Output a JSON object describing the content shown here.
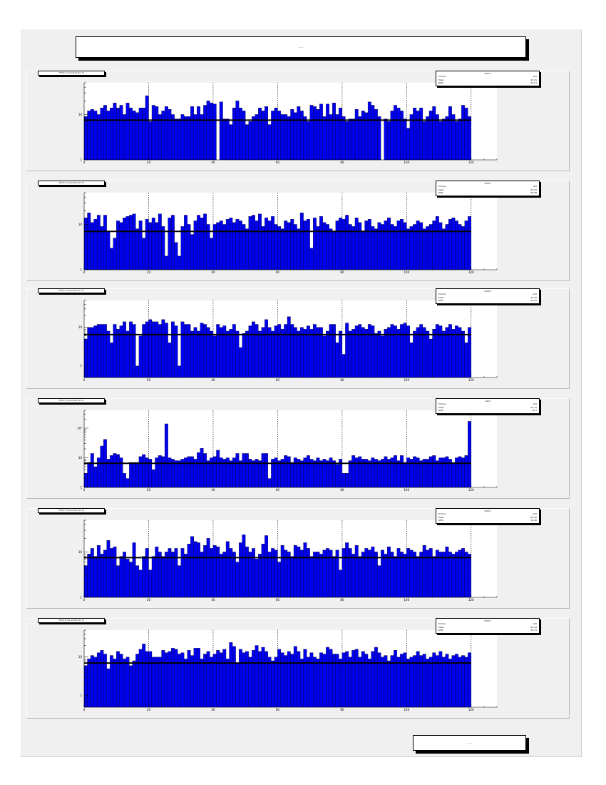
{
  "page": {
    "title": "~~~",
    "footer": "~~~"
  },
  "colors": {
    "fill": "#0000ee",
    "edge": "#000000",
    "mean_line": "#000000",
    "grid": "#000000"
  },
  "chart_data": [
    {
      "type": "bar",
      "hist_title": "TT0-T1 Corrected Pol. B",
      "stats_name": "StdPol",
      "log_y": true,
      "xlim": [
        0,
        128
      ],
      "x_ticks": [
        0,
        20,
        40,
        60,
        80,
        100,
        120
      ],
      "ylim": [
        1,
        50
      ],
      "y_ticks": [
        1,
        10
      ],
      "y_tick_labels": [
        "1",
        "10"
      ],
      "mean_line": 7.5,
      "stats": [
        {
          "label": "Entries",
          "value": "120"
        },
        {
          "label": "Mean",
          "value": "60.61"
        },
        {
          "label": "RMS",
          "value": "34.57"
        }
      ],
      "values": [
        9,
        12,
        13,
        12,
        10,
        14,
        16,
        12,
        14,
        18,
        14,
        16,
        10,
        18,
        14,
        12,
        11,
        14,
        14,
        26,
        7,
        16,
        15,
        10,
        12,
        15,
        13,
        10,
        8,
        8,
        10,
        9,
        9,
        15,
        10,
        15,
        10,
        16,
        20,
        18,
        17,
        1,
        19,
        8,
        8,
        6,
        14,
        20,
        14,
        12,
        6,
        7,
        9,
        10,
        14,
        12,
        15,
        6,
        12,
        14,
        12,
        10,
        10,
        9,
        13,
        11,
        15,
        12,
        9,
        7,
        16,
        15,
        13,
        17,
        9,
        17,
        10,
        18,
        10,
        14,
        9,
        7,
        8,
        8,
        13,
        9,
        12,
        11,
        19,
        16,
        13,
        9,
        1,
        8,
        7,
        12,
        16,
        14,
        12,
        8,
        5,
        10,
        14,
        12,
        14,
        7,
        9,
        12,
        15,
        10,
        7,
        8,
        9,
        15,
        10,
        7,
        8,
        16,
        14,
        9
      ]
    },
    {
      "type": "bar",
      "hist_title": "TS0-T2 Corrected Pol. B",
      "stats_name": "StdPol",
      "log_y": true,
      "xlim": [
        0,
        128
      ],
      "x_ticks": [
        0,
        20,
        40,
        60,
        80,
        100,
        120
      ],
      "ylim": [
        1,
        50
      ],
      "y_ticks": [
        1,
        10
      ],
      "y_tick_labels": [
        "1",
        "10"
      ],
      "mean_line": 7,
      "stats": [
        {
          "label": "Entries",
          "value": "120"
        },
        {
          "label": "Mean",
          "value": "61.52"
        },
        {
          "label": "RMS",
          "value": "34.88"
        }
      ],
      "values": [
        14,
        18,
        11,
        13,
        16,
        9,
        16,
        7,
        3,
        5,
        12,
        11,
        14,
        15,
        16,
        17,
        8,
        12,
        5,
        13,
        11,
        14,
        11,
        17,
        9,
        2,
        14,
        16,
        4,
        2,
        9,
        16,
        10,
        6,
        12,
        16,
        14,
        17,
        10,
        5,
        10,
        11,
        12,
        10,
        13,
        14,
        11,
        13,
        12,
        10,
        8,
        15,
        16,
        12,
        17,
        9,
        14,
        12,
        15,
        10,
        9,
        8,
        12,
        11,
        13,
        10,
        8,
        18,
        12,
        13,
        3,
        14,
        9,
        15,
        11,
        10,
        8,
        7,
        12,
        14,
        13,
        16,
        10,
        9,
        14,
        11,
        7,
        12,
        13,
        9,
        8,
        11,
        10,
        12,
        14,
        10,
        9,
        12,
        13,
        11,
        8,
        9,
        10,
        12,
        11,
        8,
        9,
        10,
        12,
        15,
        11,
        8,
        10,
        13,
        14,
        12,
        10,
        9,
        12,
        15
      ]
    },
    {
      "type": "bar",
      "hist_title": "TS0-T3 Corrected Pol. B",
      "stats_name": "StdPol",
      "log_y": true,
      "xlim": [
        0,
        128
      ],
      "x_ticks": [
        0,
        20,
        40,
        60,
        80,
        100,
        120
      ],
      "ylim": [
        0.5,
        50
      ],
      "y_ticks": [
        1,
        10
      ],
      "y_tick_labels": [
        "1",
        "10"
      ],
      "mean_line": 6.5,
      "stats": [
        {
          "label": "Entries",
          "value": "120"
        },
        {
          "label": "Mean",
          "value": "59.76"
        },
        {
          "label": "RMS",
          "value": "34.61"
        }
      ],
      "values": [
        5,
        10,
        10,
        11,
        12,
        12,
        12,
        8,
        4,
        12,
        9,
        11,
        14,
        8,
        14,
        12,
        1,
        6,
        12,
        14,
        16,
        14,
        14,
        12,
        16,
        13,
        4,
        14,
        11,
        1,
        14,
        12,
        12,
        8,
        10,
        8,
        13,
        12,
        10,
        8,
        6,
        12,
        10,
        11,
        8,
        9,
        12,
        8,
        3,
        7,
        8,
        11,
        14,
        12,
        8,
        10,
        16,
        10,
        8,
        11,
        12,
        9,
        12,
        19,
        12,
        10,
        8,
        10,
        9,
        11,
        9,
        12,
        10,
        10,
        6,
        8,
        12,
        12,
        4,
        8,
        2,
        13,
        8,
        9,
        11,
        12,
        10,
        9,
        12,
        11,
        7,
        8,
        6,
        9,
        10,
        12,
        11,
        9,
        12,
        13,
        11,
        4,
        8,
        10,
        12,
        10,
        8,
        5,
        9,
        12,
        11,
        8,
        10,
        12,
        9,
        11,
        10,
        8,
        4,
        10
      ]
    },
    {
      "type": "bar",
      "hist_title": "TS0-T4 Corrected Pol. B",
      "stats_name": "LaPol",
      "log_y": true,
      "xlim": [
        0,
        128
      ],
      "x_ticks": [
        0,
        20,
        40,
        60,
        80,
        100,
        120
      ],
      "ylim": [
        1,
        400
      ],
      "y_ticks": [
        1,
        10,
        100
      ],
      "y_tick_labels": [
        "1",
        "10",
        "10²"
      ],
      "mean_line": 6.5,
      "stats": [
        {
          "label": "Entries",
          "value": "120"
        },
        {
          "label": "Mean",
          "value": "61.47"
        },
        {
          "label": "RMS",
          "value": "28.7"
        }
      ],
      "values": [
        3,
        7,
        14,
        5,
        10,
        25,
        42,
        9,
        12,
        14,
        13,
        10,
        3,
        2,
        7,
        7,
        7,
        11,
        13,
        10,
        9,
        4,
        10,
        12,
        11,
        140,
        10,
        9,
        8,
        8,
        9,
        10,
        11,
        11,
        9,
        15,
        21,
        14,
        8,
        10,
        11,
        18,
        10,
        9,
        10,
        8,
        10,
        14,
        8,
        14,
        14,
        9,
        8,
        9,
        8,
        14,
        14,
        2,
        9,
        10,
        8,
        9,
        12,
        11,
        7,
        10,
        9,
        8,
        10,
        12,
        9,
        8,
        10,
        8,
        9,
        8,
        10,
        8,
        6,
        9,
        3,
        3,
        8,
        12,
        10,
        11,
        9,
        9,
        8,
        10,
        9,
        8,
        9,
        11,
        9,
        10,
        12,
        8,
        12,
        7,
        10,
        9,
        11,
        10,
        8,
        9,
        9,
        11,
        12,
        8,
        10,
        10,
        11,
        9,
        7,
        10,
        11,
        10,
        12,
        170
      ]
    },
    {
      "type": "bar",
      "hist_title": "TS0-T5 Corrected Pol. B",
      "stats_name": "StdPol",
      "log_y": true,
      "xlim": [
        0,
        128
      ],
      "x_ticks": [
        0,
        20,
        40,
        60,
        80,
        100,
        120
      ],
      "ylim": [
        1,
        50
      ],
      "y_ticks": [
        1,
        10
      ],
      "y_tick_labels": [
        "1",
        "10"
      ],
      "mean_line": 7.5,
      "stats": [
        {
          "label": "Entries",
          "value": "120"
        },
        {
          "label": "Mean",
          "value": "60.06"
        },
        {
          "label": "RMS",
          "value": "34.86"
        }
      ],
      "values": [
        5,
        9,
        12,
        8,
        14,
        9,
        11,
        18,
        12,
        13,
        5,
        8,
        10,
        7,
        6,
        16,
        5,
        4,
        8,
        12,
        4,
        8,
        13,
        10,
        8,
        10,
        12,
        10,
        12,
        5,
        12,
        9,
        15,
        22,
        17,
        16,
        10,
        14,
        20,
        12,
        14,
        13,
        9,
        10,
        17,
        12,
        10,
        6,
        16,
        24,
        13,
        10,
        12,
        7,
        9,
        15,
        23,
        10,
        12,
        11,
        6,
        14,
        11,
        10,
        8,
        14,
        13,
        11,
        16,
        12,
        8,
        10,
        10,
        9,
        11,
        12,
        11,
        8,
        11,
        4,
        12,
        16,
        12,
        9,
        14,
        8,
        10,
        12,
        11,
        13,
        10,
        5,
        11,
        9,
        13,
        10,
        8,
        12,
        10,
        9,
        12,
        11,
        10,
        8,
        10,
        14,
        11,
        12,
        8,
        11,
        10,
        10,
        13,
        10,
        9,
        10,
        11,
        12,
        10,
        9
      ]
    },
    {
      "type": "bar",
      "hist_title": "TS0-T6 Corrected Pol. B",
      "stats_name": "StdPol",
      "log_y": true,
      "xlim": [
        0,
        128
      ],
      "x_ticks": [
        0,
        20,
        40,
        60,
        80,
        100,
        120
      ],
      "ylim": [
        0.5,
        50
      ],
      "y_ticks": [
        1,
        10
      ],
      "y_tick_labels": [
        "1",
        "10"
      ],
      "mean_line": 7,
      "stats": [
        {
          "label": "Entries",
          "value": "120"
        },
        {
          "label": "Mean",
          "value": "60.18"
        },
        {
          "label": "RMS",
          "value": "33.73"
        }
      ],
      "values": [
        6,
        9,
        11,
        10,
        13,
        15,
        12,
        5,
        11,
        9,
        14,
        12,
        9,
        10,
        6,
        8,
        12,
        16,
        22,
        14,
        14,
        10,
        10,
        10,
        15,
        13,
        14,
        17,
        16,
        12,
        13,
        9,
        15,
        11,
        17,
        17,
        9,
        12,
        14,
        10,
        12,
        15,
        13,
        16,
        9,
        24,
        19,
        7,
        16,
        13,
        14,
        10,
        15,
        20,
        14,
        18,
        14,
        10,
        8,
        10,
        16,
        13,
        11,
        14,
        12,
        19,
        14,
        9,
        16,
        10,
        13,
        10,
        9,
        13,
        12,
        18,
        16,
        12,
        12,
        9,
        13,
        14,
        10,
        15,
        16,
        10,
        14,
        12,
        9,
        14,
        18,
        13,
        10,
        11,
        8,
        11,
        15,
        10,
        12,
        13,
        9,
        10,
        11,
        14,
        11,
        12,
        9,
        10,
        13,
        11,
        14,
        10,
        12,
        9,
        11,
        12,
        10,
        11,
        10,
        13
      ]
    }
  ]
}
